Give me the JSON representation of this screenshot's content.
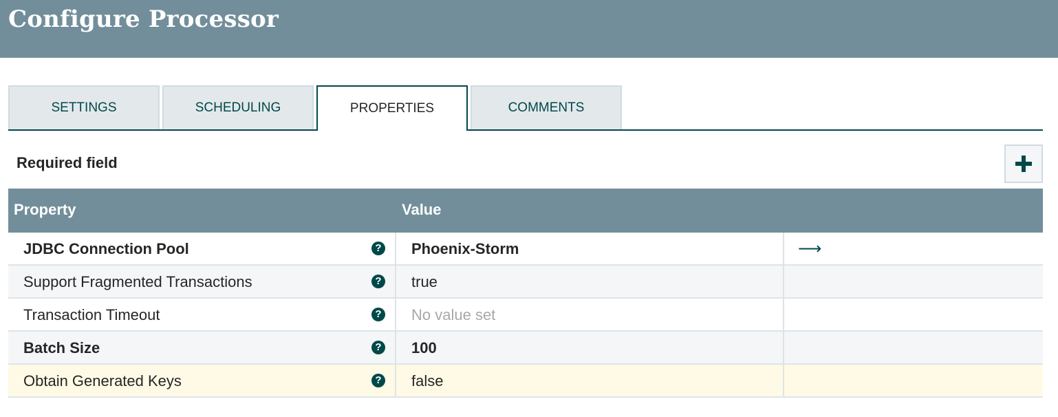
{
  "dialog": {
    "title": "Configure Processor"
  },
  "tabs": [
    {
      "label": "SETTINGS"
    },
    {
      "label": "SCHEDULING"
    },
    {
      "label": "PROPERTIES",
      "active": true
    },
    {
      "label": "COMMENTS"
    }
  ],
  "properties": {
    "required_label": "Required field",
    "add_icon": "plus-icon",
    "columns": {
      "property": "Property",
      "value": "Value"
    },
    "rows": [
      {
        "name": "JDBC Connection Pool",
        "value": "Phoenix-Storm",
        "required": true,
        "has_goto": true
      },
      {
        "name": "Support Fragmented Transactions",
        "value": "true",
        "required": false
      },
      {
        "name": "Transaction Timeout",
        "value": "No value set",
        "required": false,
        "empty": true
      },
      {
        "name": "Batch Size",
        "value": "100",
        "required": true
      },
      {
        "name": "Obtain Generated Keys",
        "value": "false",
        "required": false,
        "highlighted": true
      }
    ]
  },
  "colors": {
    "header_bg": "#728e9b",
    "accent": "#004849",
    "highlight_row": "#fffae6"
  }
}
